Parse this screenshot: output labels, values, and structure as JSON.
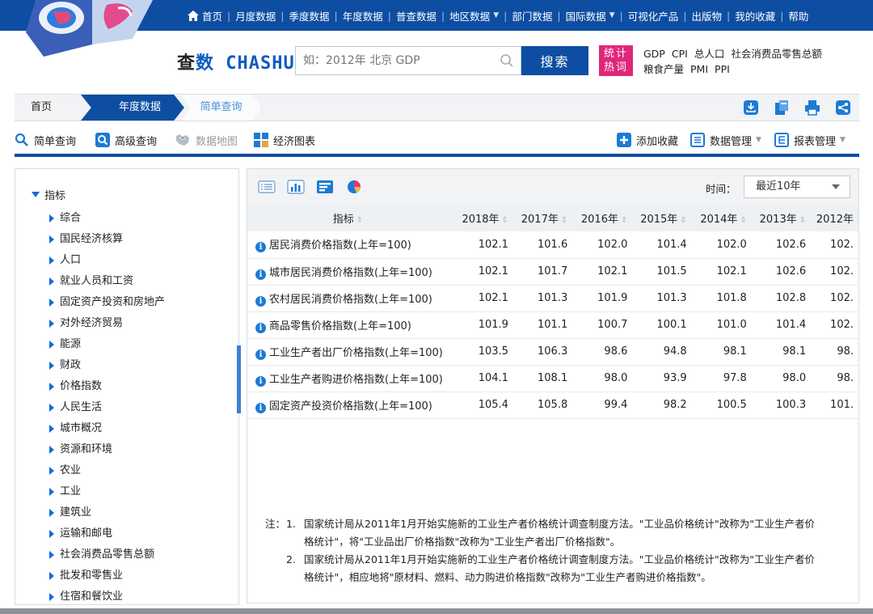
{
  "top_nav": {
    "items": [
      {
        "label": "首页",
        "icon": "home-icon"
      },
      {
        "label": "月度数据"
      },
      {
        "label": "季度数据"
      },
      {
        "label": "年度数据"
      },
      {
        "label": "普查数据"
      },
      {
        "label": "地区数据",
        "dropdown": true
      },
      {
        "label": "部门数据"
      },
      {
        "label": "国际数据",
        "dropdown": true
      },
      {
        "label": "可视化产品"
      },
      {
        "label": "出版物"
      },
      {
        "label": "我的收藏"
      },
      {
        "label": "帮助"
      }
    ]
  },
  "brand": {
    "part1": "查",
    "part2": "数",
    "part3": " CHASHU"
  },
  "search": {
    "placeholder": "如：2012年 北京 GDP",
    "button": "搜索"
  },
  "hot": {
    "badge_line1": "统计",
    "badge_line2": "热词",
    "row1": [
      "GDP",
      "CPI",
      "总人口",
      "社会消费品零售总额"
    ],
    "row2": [
      "粮食产量",
      "PMI",
      "PPI"
    ]
  },
  "breadcrumb": {
    "home": "首页",
    "year": "年度数据",
    "simple": "简单查询"
  },
  "toolbar": {
    "simple_query": "简单查询",
    "advanced_query": "高级查询",
    "data_map": "数据地图",
    "econ_chart": "经济图表",
    "add_favorite": "添加收藏",
    "data_manage": "数据管理",
    "report_manage": "报表管理"
  },
  "sidebar": {
    "root": "指标",
    "items": [
      "综合",
      "国民经济核算",
      "人口",
      "就业人员和工资",
      "固定资产投资和房地产",
      "对外经济贸易",
      "能源",
      "财政",
      "价格指数",
      "人民生活",
      "城市概况",
      "资源和环境",
      "农业",
      "工业",
      "建筑业",
      "运输和邮电",
      "社会消费品零售总额",
      "批发和零售业",
      "住宿和餐饮业"
    ]
  },
  "main": {
    "time_label": "时间：",
    "time_value": "最近10年",
    "table": {
      "headers": [
        "指标",
        "2018年",
        "2017年",
        "2016年",
        "2015年",
        "2014年",
        "2013年",
        "2012年"
      ],
      "rows": [
        {
          "name": "居民消费价格指数(上年=100)",
          "values": [
            "102.1",
            "101.6",
            "102.0",
            "101.4",
            "102.0",
            "102.6",
            "102."
          ]
        },
        {
          "name": "城市居民消费价格指数(上年=100)",
          "values": [
            "102.1",
            "101.7",
            "102.1",
            "101.5",
            "102.1",
            "102.6",
            "102."
          ]
        },
        {
          "name": "农村居民消费价格指数(上年=100)",
          "values": [
            "102.1",
            "101.3",
            "101.9",
            "101.3",
            "101.8",
            "102.8",
            "102."
          ]
        },
        {
          "name": "商品零售价格指数(上年=100)",
          "values": [
            "101.9",
            "101.1",
            "100.7",
            "100.1",
            "101.0",
            "101.4",
            "102."
          ]
        },
        {
          "name": "工业生产者出厂价格指数(上年=100)",
          "values": [
            "103.5",
            "106.3",
            "98.6",
            "94.8",
            "98.1",
            "98.1",
            "98."
          ]
        },
        {
          "name": "工业生产者购进价格指数(上年=100)",
          "values": [
            "104.1",
            "108.1",
            "98.0",
            "93.9",
            "97.8",
            "98.0",
            "98."
          ]
        },
        {
          "name": "固定资产投资价格指数(上年=100)",
          "values": [
            "105.4",
            "105.8",
            "99.4",
            "98.2",
            "100.5",
            "100.3",
            "101."
          ]
        }
      ]
    },
    "notes": {
      "label": "注：",
      "items": [
        {
          "num": "1.",
          "lines": [
            "国家统计局从2011年1月开始实施新的工业生产者价格统计调查制度方法。\"工业品价格统计\"改称为\"工业生产者价",
            "格统计\"，将\"工业品出厂价格指数\"改称为\"工业生产者出厂价格指数\"。"
          ]
        },
        {
          "num": "2.",
          "lines": [
            "国家统计局从2011年1月开始实施新的工业生产者价格统计调查制度方法。\"工业品价格统计\"改称为\"工业生产者价",
            "格统计\"，相应地将\"原材料、燃料、动力购进价格指数\"改称为\"工业生产者购进价格指数\"。"
          ]
        }
      ]
    }
  },
  "colors": {
    "nav_blue": "#0d4ea3",
    "accent_blue": "#1c7ad6",
    "hot_pink": "#e0277a"
  }
}
